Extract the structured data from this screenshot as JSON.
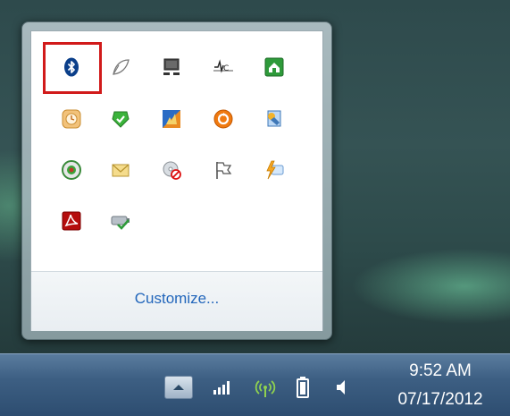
{
  "popup": {
    "customize_label": "Customize...",
    "icons": [
      {
        "name": "bluetooth-icon"
      },
      {
        "name": "leaf-shape-icon"
      },
      {
        "name": "network-computer-icon"
      },
      {
        "name": "vc-signal-icon"
      },
      {
        "name": "green-house-icon"
      },
      {
        "name": "clock-app-icon"
      },
      {
        "name": "green-check-shield-icon"
      },
      {
        "name": "colorful-hand-icon"
      },
      {
        "name": "orange-refresh-icon"
      },
      {
        "name": "blue-wizard-icon"
      },
      {
        "name": "green-circle-app-icon"
      },
      {
        "name": "envelope-icon"
      },
      {
        "name": "disc-blocked-icon"
      },
      {
        "name": "white-flag-icon"
      },
      {
        "name": "lightning-chat-icon"
      },
      {
        "name": "acrobat-pdf-icon"
      },
      {
        "name": "safely-remove-hardware-icon"
      }
    ]
  },
  "taskbar": {
    "clock_time": "9:52 AM",
    "clock_date": "07/17/2012"
  },
  "colors": {
    "highlight": "#d11a1a",
    "link": "#2266bb"
  }
}
